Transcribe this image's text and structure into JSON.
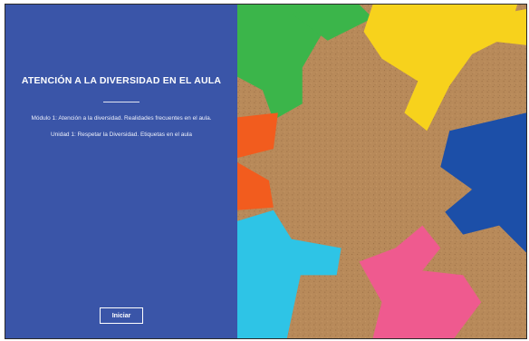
{
  "intro": {
    "title": "ATENCIÓN A LA DIVERSIDAD EN EL AULA",
    "module_line": "Módulo 1: Atención a la diversidad. Realidades frecuentes en el aula.",
    "unit_line": "Unidad 1: Respetar la Diversidad. Etiquetas en el aula",
    "start_button_label": "Iniciar"
  },
  "image": {
    "icon": "paper-people-circle-image",
    "colors": {
      "panel": "#3a55a8",
      "cork": "#b88a5a",
      "green": "#3bb54a",
      "yellow": "#f7d21c",
      "blue": "#1c4fa8",
      "cyan": "#2ec4e6",
      "pink": "#ef5a8f",
      "orange": "#f25c1e"
    }
  }
}
